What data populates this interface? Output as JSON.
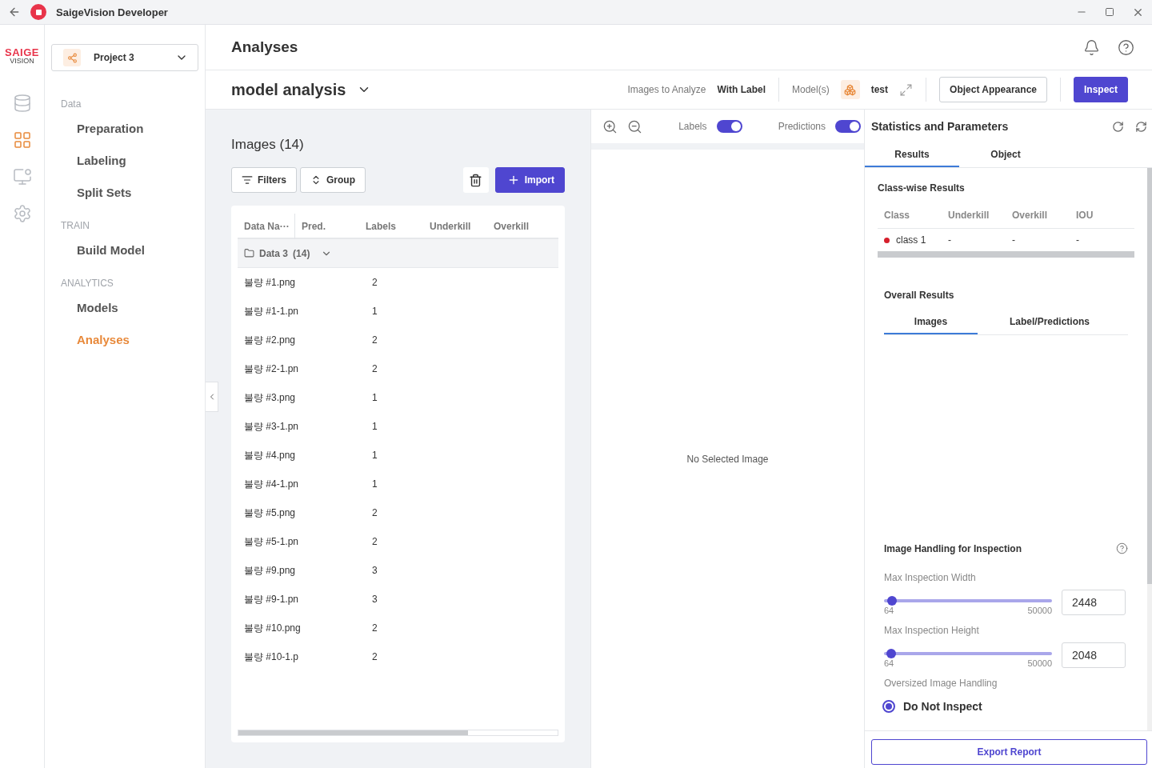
{
  "window": {
    "title": "SaigeVision Developer"
  },
  "logo": {
    "top": "SAIGE",
    "bottom": "VISION"
  },
  "rail": [
    {
      "kind": "database",
      "selected": false
    },
    {
      "kind": "grid",
      "selected": true
    },
    {
      "kind": "monitor",
      "selected": false
    },
    {
      "kind": "gear",
      "selected": false
    }
  ],
  "project": {
    "name": "Project 3"
  },
  "sidebar": {
    "sections": [
      {
        "title": "Data",
        "items": [
          {
            "label": "Preparation",
            "selected": false
          },
          {
            "label": "Labeling",
            "selected": false
          },
          {
            "label": "Split Sets",
            "selected": false
          }
        ]
      },
      {
        "title": "TRAIN",
        "items": [
          {
            "label": "Build Model",
            "selected": false
          }
        ]
      },
      {
        "title": "ANALYTICS",
        "items": [
          {
            "label": "Models",
            "selected": false
          },
          {
            "label": "Analyses",
            "selected": true
          }
        ]
      }
    ]
  },
  "page_title": "Analyses",
  "analysis": {
    "name": "model analysis",
    "images_label": "Images to Analyze",
    "images_value": "With Label",
    "models_label": "Model(s)",
    "model": "test",
    "buttons": [
      {
        "label": "Object Appearance",
        "kind": "outline"
      },
      {
        "label": "Inspect",
        "kind": "primary"
      }
    ]
  },
  "images": {
    "title": "Images (14)",
    "filters": "Filters",
    "group": "Group",
    "import": "Import",
    "columns": [
      "Data Na···",
      "Pred.",
      "Labels",
      "Underkill",
      "Overkill"
    ],
    "group_row": {
      "name": "Data 3",
      "count": "(14)",
      "expanded": true
    },
    "rows": [
      {
        "name": "불량 #1.png",
        "labels": "2"
      },
      {
        "name": "불량 #1-1.pn",
        "labels": "1"
      },
      {
        "name": "불량 #2.png",
        "labels": "2"
      },
      {
        "name": "불량 #2-1.pn",
        "labels": "2"
      },
      {
        "name": "불량 #3.png",
        "labels": "1"
      },
      {
        "name": "불량 #3-1.pn",
        "labels": "1"
      },
      {
        "name": "불량 #4.png",
        "labels": "1"
      },
      {
        "name": "불량 #4-1.pn",
        "labels": "1"
      },
      {
        "name": "불량 #5.png",
        "labels": "2"
      },
      {
        "name": "불량 #5-1.pn",
        "labels": "2"
      },
      {
        "name": "불량 #9.png",
        "labels": "3"
      },
      {
        "name": "불량 #9-1.pn",
        "labels": "3"
      },
      {
        "name": "불량 #10.png",
        "labels": "2"
      },
      {
        "name": "불량 #10-1.p",
        "labels": "2"
      }
    ]
  },
  "viewer": {
    "toggles": [
      {
        "label": "Labels",
        "on": true
      },
      {
        "label": "Predictions",
        "on": true
      }
    ],
    "empty": "No Selected Image"
  },
  "stats": {
    "title": "Statistics and Parameters",
    "tabs": [
      {
        "label": "Results",
        "selected": true
      },
      {
        "label": "Object",
        "selected": false
      }
    ],
    "classwise": {
      "title": "Class-wise Results",
      "columns": [
        "Class",
        "Underkill",
        "Overkill",
        "IOU"
      ],
      "rows": [
        {
          "name": "class 1",
          "color": "#d61f2c",
          "underkill": "-",
          "overkill": "-",
          "iou": "-"
        }
      ]
    },
    "overall": {
      "title": "Overall Results",
      "tabs": [
        {
          "label": "Images",
          "selected": true
        },
        {
          "label": "Label/Predictions",
          "selected": false
        }
      ]
    },
    "handling": {
      "title": "Image Handling for Inspection",
      "sliders": [
        {
          "label": "Max Inspection Width",
          "min": "64",
          "max": "50000",
          "value": "2448",
          "level": 0.03
        },
        {
          "label": "Max Inspection Height",
          "min": "64",
          "max": "50000",
          "value": "2048",
          "level": 0.022
        }
      ],
      "oversized_label": "Oversized Image Handling",
      "options": [
        {
          "label": "Do Not Inspect",
          "selected": true
        }
      ]
    },
    "export": "Export Report"
  }
}
